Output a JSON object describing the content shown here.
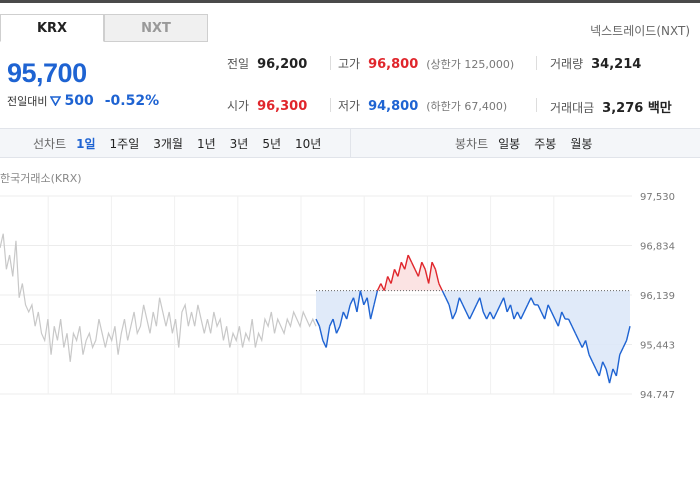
{
  "tabs": [
    {
      "label": "KRX",
      "active": true
    },
    {
      "label": "NXT",
      "active": false
    }
  ],
  "exchange_link": "넥스트레이드(NXT)",
  "price": {
    "current": "95,700",
    "diff_label": "전일대비",
    "diff_value": "500",
    "diff_pct": "-0.52%",
    "direction": "down"
  },
  "stats": {
    "prev_close": {
      "label": "전일",
      "value": "96,200"
    },
    "open": {
      "label": "시가",
      "value": "96,300"
    },
    "high": {
      "label": "고가",
      "value": "96,800",
      "sub": "(상한가 125,000)"
    },
    "low": {
      "label": "저가",
      "value": "94,800",
      "sub": "(하한가 67,400)"
    },
    "volume": {
      "label": "거래량",
      "value": "34,214"
    },
    "amount": {
      "label": "거래대금",
      "value": "3,276 백만"
    }
  },
  "period": {
    "line_head": "선차트",
    "line_items": [
      "1일",
      "1주일",
      "3개월",
      "1년",
      "3년",
      "5년",
      "10년"
    ],
    "line_selected": 0,
    "candle_head": "봉차트",
    "candle_items": [
      "일봉",
      "주봉",
      "월봉"
    ]
  },
  "market_label": "한국거래소(KRX)",
  "colors": {
    "up": "#e0262c",
    "down": "#1e63d2",
    "prev_day_line": "#c8c8c8"
  },
  "chart_data": {
    "type": "line",
    "y_ticks": [
      "97,530",
      "96,834",
      "96,139",
      "95,443",
      "94,747"
    ],
    "ylim": [
      94747,
      97530
    ],
    "reference_price": 96200,
    "grid": true,
    "series": [
      {
        "values": [
          96800,
          97000,
          96500,
          96700,
          96400,
          96900,
          96100,
          96300,
          96000,
          95900,
          96000,
          95700,
          95900,
          95600,
          95500,
          95800,
          95300,
          95700,
          95500,
          95800,
          95400,
          95600,
          95200,
          95600,
          95500,
          95700,
          95300,
          95500,
          95600,
          95400,
          95500,
          95800,
          95600,
          95400,
          95600,
          95500,
          95700,
          95300,
          95600,
          95800,
          95500,
          95700,
          95900,
          95600,
          95700,
          96000,
          95800,
          95600,
          95900,
          95700,
          96100,
          95900,
          95700,
          95900,
          95600,
          95800,
          95400,
          95900,
          96000,
          95700,
          95900,
          95700,
          96000,
          95800,
          95600,
          95800,
          95600,
          95900,
          95700,
          95800,
          95500,
          95700,
          95400,
          95600,
          95500,
          95700,
          95400,
          95600,
          95500,
          95800,
          95400,
          95600,
          95500,
          95800,
          95700,
          95900,
          95600,
          95800,
          95700,
          95600,
          95800,
          95700,
          95900,
          95800,
          95700,
          95900,
          95800,
          95700,
          95800,
          95700
        ]
      },
      {
        "values": [
          95800,
          95700,
          95500,
          95400,
          95700,
          95800,
          95600,
          95700,
          95900,
          95800,
          96000,
          96100,
          95900,
          96200,
          96000,
          96100,
          95800,
          96000,
          96200,
          96300,
          96200,
          96400,
          96300,
          96500,
          96400,
          96600,
          96500,
          96700,
          96600,
          96500,
          96400,
          96600,
          96500,
          96300,
          96600,
          96500,
          96300,
          96200,
          96100,
          96000,
          95800,
          95900,
          96100,
          96000,
          95900,
          95800,
          95900,
          96000,
          96100,
          95900,
          95800,
          95900,
          95800,
          95900,
          96000,
          96100,
          95900,
          96000,
          95800,
          95900,
          95800,
          95900,
          96000,
          96100,
          96000,
          96000,
          95900,
          95800,
          96000,
          95900,
          95800,
          95700,
          95900,
          95800,
          95800,
          95700,
          95600,
          95500,
          95400,
          95500,
          95300,
          95200,
          95100,
          95000,
          95200,
          95100,
          94900,
          95100,
          95000,
          95300,
          95400,
          95500,
          95700
        ]
      }
    ]
  }
}
